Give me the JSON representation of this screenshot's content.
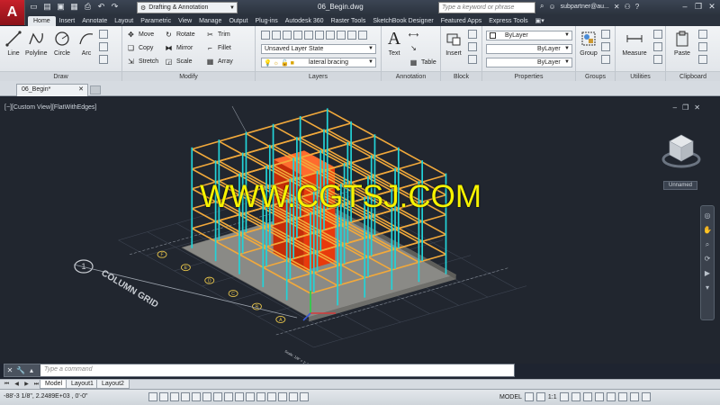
{
  "title_bar": {
    "app_menu_letter": "A",
    "workspace": "Drafting & Annotation",
    "document_title": "06_Begin.dwg",
    "search_placeholder": "Type a keyword or phrase",
    "user": "subpartner@au..."
  },
  "ribbon_tabs": [
    "Home",
    "Insert",
    "Annotate",
    "Layout",
    "Parametric",
    "View",
    "Manage",
    "Output",
    "Plug-ins",
    "Autodesk 360",
    "Raster Tools",
    "SketchBook Designer",
    "Featured Apps",
    "Express Tools"
  ],
  "ribbon": {
    "draw": {
      "title": "Draw",
      "line": "Line",
      "polyline": "Polyline",
      "circle": "Circle",
      "arc": "Arc"
    },
    "modify": {
      "title": "Modify",
      "move": "Move",
      "rotate": "Rotate",
      "trim": "Trim",
      "copy": "Copy",
      "mirror": "Mirror",
      "fillet": "Fillet",
      "stretch": "Stretch",
      "scale": "Scale",
      "array": "Array"
    },
    "layers": {
      "title": "Layers",
      "layer_state": "Unsaved Layer State",
      "current_layer": "lateral bracing"
    },
    "annotation": {
      "title": "Annotation",
      "text": "Text",
      "table": "Table"
    },
    "block": {
      "title": "Block",
      "insert": "Insert"
    },
    "properties": {
      "title": "Properties",
      "color": "ByLayer",
      "linetype": "ByLayer",
      "lineweight": "ByLayer"
    },
    "groups": {
      "title": "Groups",
      "group": "Group"
    },
    "utilities": {
      "title": "Utilities",
      "measure": "Measure"
    },
    "clipboard": {
      "title": "Clipboard",
      "paste": "Paste"
    }
  },
  "file_tab": "06_Begin*",
  "viewport": {
    "label": "[−][Custom View][FlatWithEdges]",
    "view_name": "Unnamed",
    "watermark": "WWW.CGTSJ.COM",
    "grid_label": "COLUMN GRID",
    "grid_bubble": "1",
    "scale_text": "Scale: 1/8\" = 1'-0\"",
    "grid_letters": [
      "A",
      "B",
      "C",
      "D",
      "E",
      "F"
    ]
  },
  "command_line": {
    "placeholder": "Type a command"
  },
  "layout_tabs": [
    "Model",
    "Layout1",
    "Layout2"
  ],
  "status_bar": {
    "coordinates": "-88'-3 1/8\",  2.2489E+03 ,  0'-0\"",
    "model_label": "MODEL",
    "scale": "1:1"
  },
  "colors": {
    "beam": "#f2a93b",
    "column": "#22d3d8",
    "core": "#e83a0c",
    "slab": "#8a8a86",
    "background": "#21262f"
  }
}
